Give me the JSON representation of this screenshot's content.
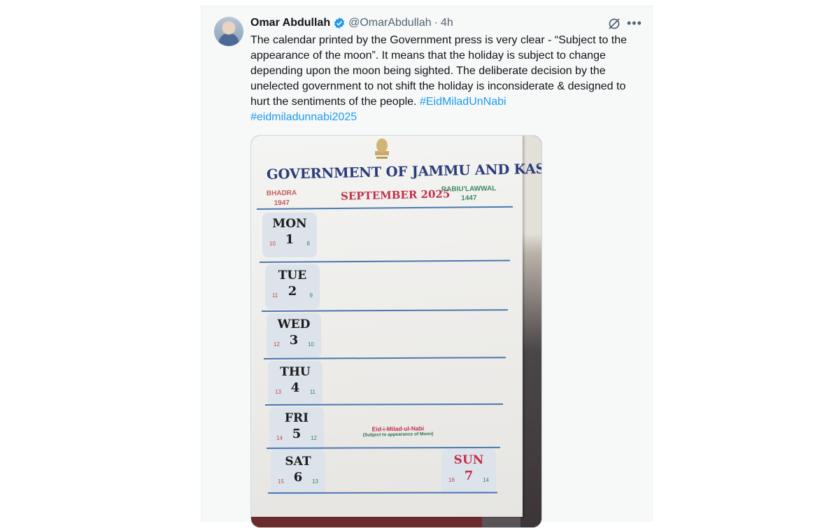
{
  "tweet": {
    "name": "Omar Abdullah",
    "handle": "@OmarAbdullah",
    "separator": "·",
    "time": "4h",
    "text_main": "The calendar printed by the Government press is very clear - “Subject to the appearance of the moon”. It means that the holiday is subject to change depending upon the moon being sighted. The deliberate decision by the unelected government to not shift the holiday is inconsiderate & designed to hurt the sentiments of the people. ",
    "hashtag1": "#EidMiladUnNabi",
    "hashtag2": "#eidmiladunnabi2025",
    "icons": [
      "verified-badge-icon",
      "grok-icon",
      "more-options-icon"
    ],
    "colors": {
      "link": "#1d9bf0",
      "verified": "#1d9bf0"
    }
  },
  "calendar": {
    "title": "GOVERNMENT OF JAMMU AND KASHMIR",
    "left_era_name": "BHADRA",
    "left_era_year": "1947",
    "month": "SEPTEMBER 2025",
    "right_era_name": "RABIU'LAWWAL",
    "right_era_year": "1447",
    "days": [
      {
        "name": "MON",
        "num": "1",
        "left": "10",
        "right": "8"
      },
      {
        "name": "TUE",
        "num": "2",
        "left": "11",
        "right": "9"
      },
      {
        "name": "WED",
        "num": "3",
        "left": "12",
        "right": "10"
      },
      {
        "name": "THU",
        "num": "4",
        "left": "13",
        "right": "11"
      },
      {
        "name": "FRI",
        "num": "5",
        "left": "14",
        "right": "12"
      },
      {
        "name": "SAT",
        "num": "6",
        "left": "15",
        "right": "13"
      }
    ],
    "sunday": {
      "name": "SUN",
      "num": "7",
      "left": "16",
      "right": "14"
    },
    "holiday_name": "Eid-i-Milad-ul-Nabi",
    "holiday_note": "(Subject to appearance of Moon)"
  }
}
